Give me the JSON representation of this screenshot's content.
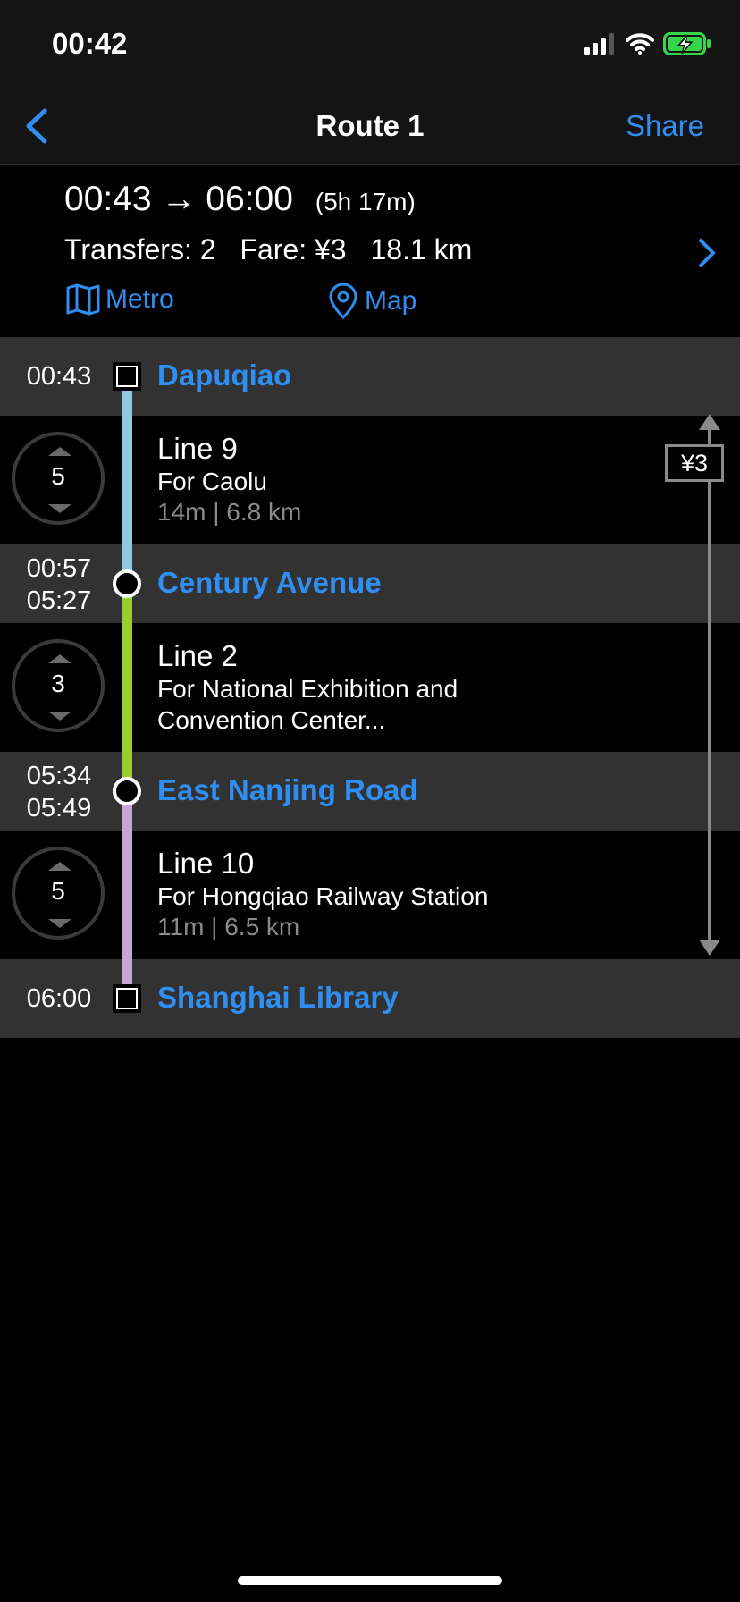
{
  "status": {
    "time": "00:42"
  },
  "nav": {
    "title": "Route 1",
    "share_label": "Share"
  },
  "summary": {
    "depart": "00:43",
    "arrow": "→",
    "arrive": "06:00",
    "duration": "(5h 17m)",
    "transfers": "Transfers: 2",
    "fare": "Fare: ¥3",
    "distance": "18.1 km",
    "metro_label": "Metro",
    "map_label": "Map"
  },
  "stations": [
    {
      "times": [
        "00:43"
      ],
      "name": "Dapuqiao"
    },
    {
      "times": [
        "00:57",
        "05:27"
      ],
      "name": "Century Avenue"
    },
    {
      "times": [
        "05:34",
        "05:49"
      ],
      "name": "East Nanjing Road"
    },
    {
      "times": [
        "06:00"
      ],
      "name": "Shanghai Library"
    }
  ],
  "segments": [
    {
      "stops": "5",
      "line": "Line 9",
      "direction": "For Caolu",
      "meta": "14m  |  6.8 km",
      "color": "#8ec9df"
    },
    {
      "stops": "3",
      "line": "Line 2",
      "direction": "For National Exhibition and Convention Center...",
      "meta": "",
      "color": "#9acd32"
    },
    {
      "stops": "5",
      "line": "Line 10",
      "direction": "For Hongqiao Railway Station",
      "meta": "11m  |  6.5 km",
      "color": "#c4a7d6"
    }
  ],
  "fare_badge": "¥3",
  "colors": {
    "accent": "#2f8ef1",
    "battery": "#32d74b"
  }
}
